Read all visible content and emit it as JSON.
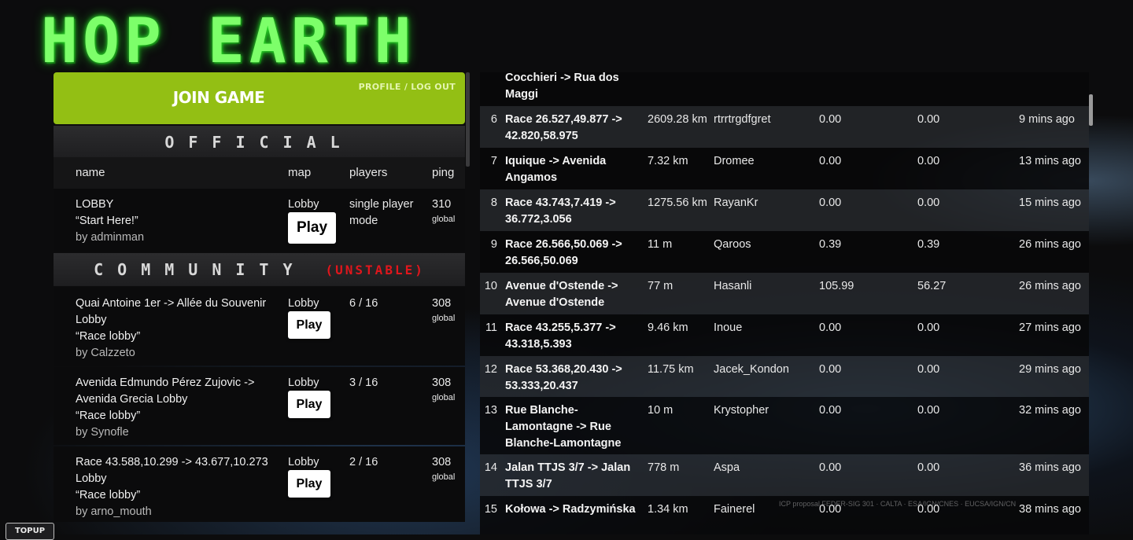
{
  "logo": {
    "text": "HOP EARTH"
  },
  "join": {
    "title": "JOIN GAME",
    "profile_link": "PROFILE / LOG OUT"
  },
  "official": {
    "heading": "OFFICIAL",
    "columns": {
      "name": "name",
      "map": "map",
      "players": "players",
      "ping": "ping"
    },
    "servers": [
      {
        "name": "LOBBY",
        "quote": "“Start Here!”",
        "by": "by adminman",
        "map": "Lobby",
        "play": "Play",
        "players": "single player mode",
        "ping": "310",
        "scope": "global"
      }
    ]
  },
  "community": {
    "heading": "COMMUNITY",
    "tag": "(UNSTABLE)",
    "servers": [
      {
        "name": "Quai Antoine 1er -> Allée du Souvenir Lobby",
        "quote": "“Race lobby”",
        "by": "by Calzzeto",
        "map": "Lobby",
        "play": "Play",
        "players": "6 / 16",
        "ping": "308",
        "scope": "global"
      },
      {
        "name": "Avenida Edmundo Pérez Zujovic -> Avenida Grecia Lobby",
        "quote": "“Race lobby”",
        "by": "by Synofle",
        "map": "Lobby",
        "play": "Play",
        "players": "3 / 16",
        "ping": "308",
        "scope": "global"
      },
      {
        "name": "Race 43.588,10.299 -> 43.677,10.273 Lobby",
        "quote": "“Race lobby”",
        "by": "by arno_mouth",
        "map": "Lobby",
        "play": "Play",
        "players": "2 / 16",
        "ping": "308",
        "scope": "global"
      }
    ]
  },
  "races": {
    "partial_top": "Cocchieri -> Rua dos Maggi",
    "rows": [
      {
        "num": "6",
        "route": "Race 26.527,49.877 -> 42.820,58.975",
        "dist": "2609.28 km",
        "player": "rtrrtrgdfgret",
        "s1": "0.00",
        "s2": "0.00",
        "time": "9 mins ago"
      },
      {
        "num": "7",
        "route": "Iquique -> Avenida Angamos",
        "dist": "7.32 km",
        "player": "Dromee",
        "s1": "0.00",
        "s2": "0.00",
        "time": "13 mins ago"
      },
      {
        "num": "8",
        "route": "Race 43.743,7.419 -> 36.772,3.056",
        "dist": "1275.56 km",
        "player": "RayanKr",
        "s1": "0.00",
        "s2": "0.00",
        "time": "15 mins ago"
      },
      {
        "num": "9",
        "route": "Race 26.566,50.069 -> 26.566,50.069",
        "dist": "11 m",
        "player": "Qaroos",
        "s1": "0.39",
        "s2": "0.39",
        "time": "26 mins ago"
      },
      {
        "num": "10",
        "route": "Avenue d'Ostende -> Avenue d'Ostende",
        "dist": "77 m",
        "player": "Hasanli",
        "s1": "105.99",
        "s2": "56.27",
        "time": "26 mins ago"
      },
      {
        "num": "11",
        "route": "Race 43.255,5.377 -> 43.318,5.393",
        "dist": "9.46 km",
        "player": "Inoue",
        "s1": "0.00",
        "s2": "0.00",
        "time": "27 mins ago"
      },
      {
        "num": "12",
        "route": "Race 53.368,20.430 -> 53.333,20.437",
        "dist": "11.75 km",
        "player": "Jacek_Kondon",
        "s1": "0.00",
        "s2": "0.00",
        "time": "29 mins ago"
      },
      {
        "num": "13",
        "route": "Rue Blanche-Lamontagne -> Rue Blanche-Lamontagne",
        "dist": "10 m",
        "player": "Krystopher",
        "s1": "0.00",
        "s2": "0.00",
        "time": "32 mins ago"
      },
      {
        "num": "14",
        "route": "Jalan TTJS 3/7 -> Jalan TTJS 3/7",
        "dist": "778 m",
        "player": "Aspa",
        "s1": "0.00",
        "s2": "0.00",
        "time": "36 mins ago"
      },
      {
        "num": "15",
        "route": "Kołowa -> Radzymińska",
        "dist": "1.34 km",
        "player": "Fainerel",
        "s1": "0.00",
        "s2": "0.00",
        "time": "38 mins ago"
      }
    ]
  },
  "attribution": "ICP proposal FEDER-SIG 301 · CALTA · ESA/IGN/CNES · EUCSA/IGN/CN",
  "corner_text": "",
  "bottom_button": "TOPUP",
  "colors": {
    "join_green": "#93bf14",
    "logo_green": "#7dff6a",
    "unstable_red": "#e0161c"
  }
}
